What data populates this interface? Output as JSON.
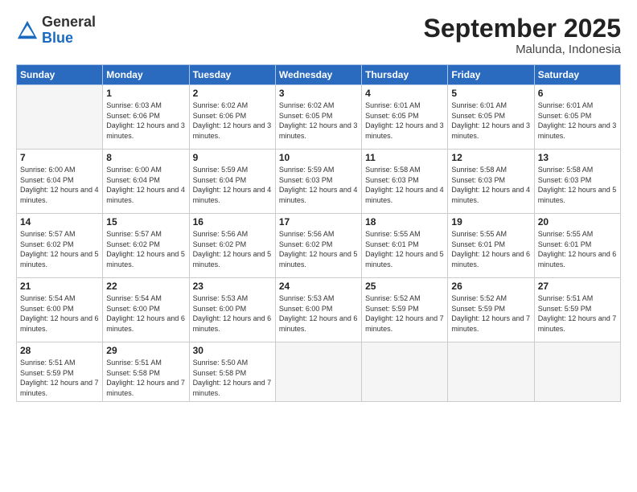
{
  "header": {
    "logo_general": "General",
    "logo_blue": "Blue",
    "month_title": "September 2025",
    "location": "Malunda, Indonesia"
  },
  "weekdays": [
    "Sunday",
    "Monday",
    "Tuesday",
    "Wednesday",
    "Thursday",
    "Friday",
    "Saturday"
  ],
  "weeks": [
    [
      {
        "day": "",
        "empty": true
      },
      {
        "day": "1",
        "sunrise": "Sunrise: 6:03 AM",
        "sunset": "Sunset: 6:06 PM",
        "daylight": "Daylight: 12 hours and 3 minutes."
      },
      {
        "day": "2",
        "sunrise": "Sunrise: 6:02 AM",
        "sunset": "Sunset: 6:06 PM",
        "daylight": "Daylight: 12 hours and 3 minutes."
      },
      {
        "day": "3",
        "sunrise": "Sunrise: 6:02 AM",
        "sunset": "Sunset: 6:05 PM",
        "daylight": "Daylight: 12 hours and 3 minutes."
      },
      {
        "day": "4",
        "sunrise": "Sunrise: 6:01 AM",
        "sunset": "Sunset: 6:05 PM",
        "daylight": "Daylight: 12 hours and 3 minutes."
      },
      {
        "day": "5",
        "sunrise": "Sunrise: 6:01 AM",
        "sunset": "Sunset: 6:05 PM",
        "daylight": "Daylight: 12 hours and 3 minutes."
      },
      {
        "day": "6",
        "sunrise": "Sunrise: 6:01 AM",
        "sunset": "Sunset: 6:05 PM",
        "daylight": "Daylight: 12 hours and 3 minutes."
      }
    ],
    [
      {
        "day": "7",
        "sunrise": "Sunrise: 6:00 AM",
        "sunset": "Sunset: 6:04 PM",
        "daylight": "Daylight: 12 hours and 4 minutes."
      },
      {
        "day": "8",
        "sunrise": "Sunrise: 6:00 AM",
        "sunset": "Sunset: 6:04 PM",
        "daylight": "Daylight: 12 hours and 4 minutes."
      },
      {
        "day": "9",
        "sunrise": "Sunrise: 5:59 AM",
        "sunset": "Sunset: 6:04 PM",
        "daylight": "Daylight: 12 hours and 4 minutes."
      },
      {
        "day": "10",
        "sunrise": "Sunrise: 5:59 AM",
        "sunset": "Sunset: 6:03 PM",
        "daylight": "Daylight: 12 hours and 4 minutes."
      },
      {
        "day": "11",
        "sunrise": "Sunrise: 5:58 AM",
        "sunset": "Sunset: 6:03 PM",
        "daylight": "Daylight: 12 hours and 4 minutes."
      },
      {
        "day": "12",
        "sunrise": "Sunrise: 5:58 AM",
        "sunset": "Sunset: 6:03 PM",
        "daylight": "Daylight: 12 hours and 4 minutes."
      },
      {
        "day": "13",
        "sunrise": "Sunrise: 5:58 AM",
        "sunset": "Sunset: 6:03 PM",
        "daylight": "Daylight: 12 hours and 5 minutes."
      }
    ],
    [
      {
        "day": "14",
        "sunrise": "Sunrise: 5:57 AM",
        "sunset": "Sunset: 6:02 PM",
        "daylight": "Daylight: 12 hours and 5 minutes."
      },
      {
        "day": "15",
        "sunrise": "Sunrise: 5:57 AM",
        "sunset": "Sunset: 6:02 PM",
        "daylight": "Daylight: 12 hours and 5 minutes."
      },
      {
        "day": "16",
        "sunrise": "Sunrise: 5:56 AM",
        "sunset": "Sunset: 6:02 PM",
        "daylight": "Daylight: 12 hours and 5 minutes."
      },
      {
        "day": "17",
        "sunrise": "Sunrise: 5:56 AM",
        "sunset": "Sunset: 6:02 PM",
        "daylight": "Daylight: 12 hours and 5 minutes."
      },
      {
        "day": "18",
        "sunrise": "Sunrise: 5:55 AM",
        "sunset": "Sunset: 6:01 PM",
        "daylight": "Daylight: 12 hours and 5 minutes."
      },
      {
        "day": "19",
        "sunrise": "Sunrise: 5:55 AM",
        "sunset": "Sunset: 6:01 PM",
        "daylight": "Daylight: 12 hours and 6 minutes."
      },
      {
        "day": "20",
        "sunrise": "Sunrise: 5:55 AM",
        "sunset": "Sunset: 6:01 PM",
        "daylight": "Daylight: 12 hours and 6 minutes."
      }
    ],
    [
      {
        "day": "21",
        "sunrise": "Sunrise: 5:54 AM",
        "sunset": "Sunset: 6:00 PM",
        "daylight": "Daylight: 12 hours and 6 minutes."
      },
      {
        "day": "22",
        "sunrise": "Sunrise: 5:54 AM",
        "sunset": "Sunset: 6:00 PM",
        "daylight": "Daylight: 12 hours and 6 minutes."
      },
      {
        "day": "23",
        "sunrise": "Sunrise: 5:53 AM",
        "sunset": "Sunset: 6:00 PM",
        "daylight": "Daylight: 12 hours and 6 minutes."
      },
      {
        "day": "24",
        "sunrise": "Sunrise: 5:53 AM",
        "sunset": "Sunset: 6:00 PM",
        "daylight": "Daylight: 12 hours and 6 minutes."
      },
      {
        "day": "25",
        "sunrise": "Sunrise: 5:52 AM",
        "sunset": "Sunset: 5:59 PM",
        "daylight": "Daylight: 12 hours and 7 minutes."
      },
      {
        "day": "26",
        "sunrise": "Sunrise: 5:52 AM",
        "sunset": "Sunset: 5:59 PM",
        "daylight": "Daylight: 12 hours and 7 minutes."
      },
      {
        "day": "27",
        "sunrise": "Sunrise: 5:51 AM",
        "sunset": "Sunset: 5:59 PM",
        "daylight": "Daylight: 12 hours and 7 minutes."
      }
    ],
    [
      {
        "day": "28",
        "sunrise": "Sunrise: 5:51 AM",
        "sunset": "Sunset: 5:59 PM",
        "daylight": "Daylight: 12 hours and 7 minutes."
      },
      {
        "day": "29",
        "sunrise": "Sunrise: 5:51 AM",
        "sunset": "Sunset: 5:58 PM",
        "daylight": "Daylight: 12 hours and 7 minutes."
      },
      {
        "day": "30",
        "sunrise": "Sunrise: 5:50 AM",
        "sunset": "Sunset: 5:58 PM",
        "daylight": "Daylight: 12 hours and 7 minutes."
      },
      {
        "day": "",
        "empty": true
      },
      {
        "day": "",
        "empty": true
      },
      {
        "day": "",
        "empty": true
      },
      {
        "day": "",
        "empty": true
      }
    ]
  ]
}
